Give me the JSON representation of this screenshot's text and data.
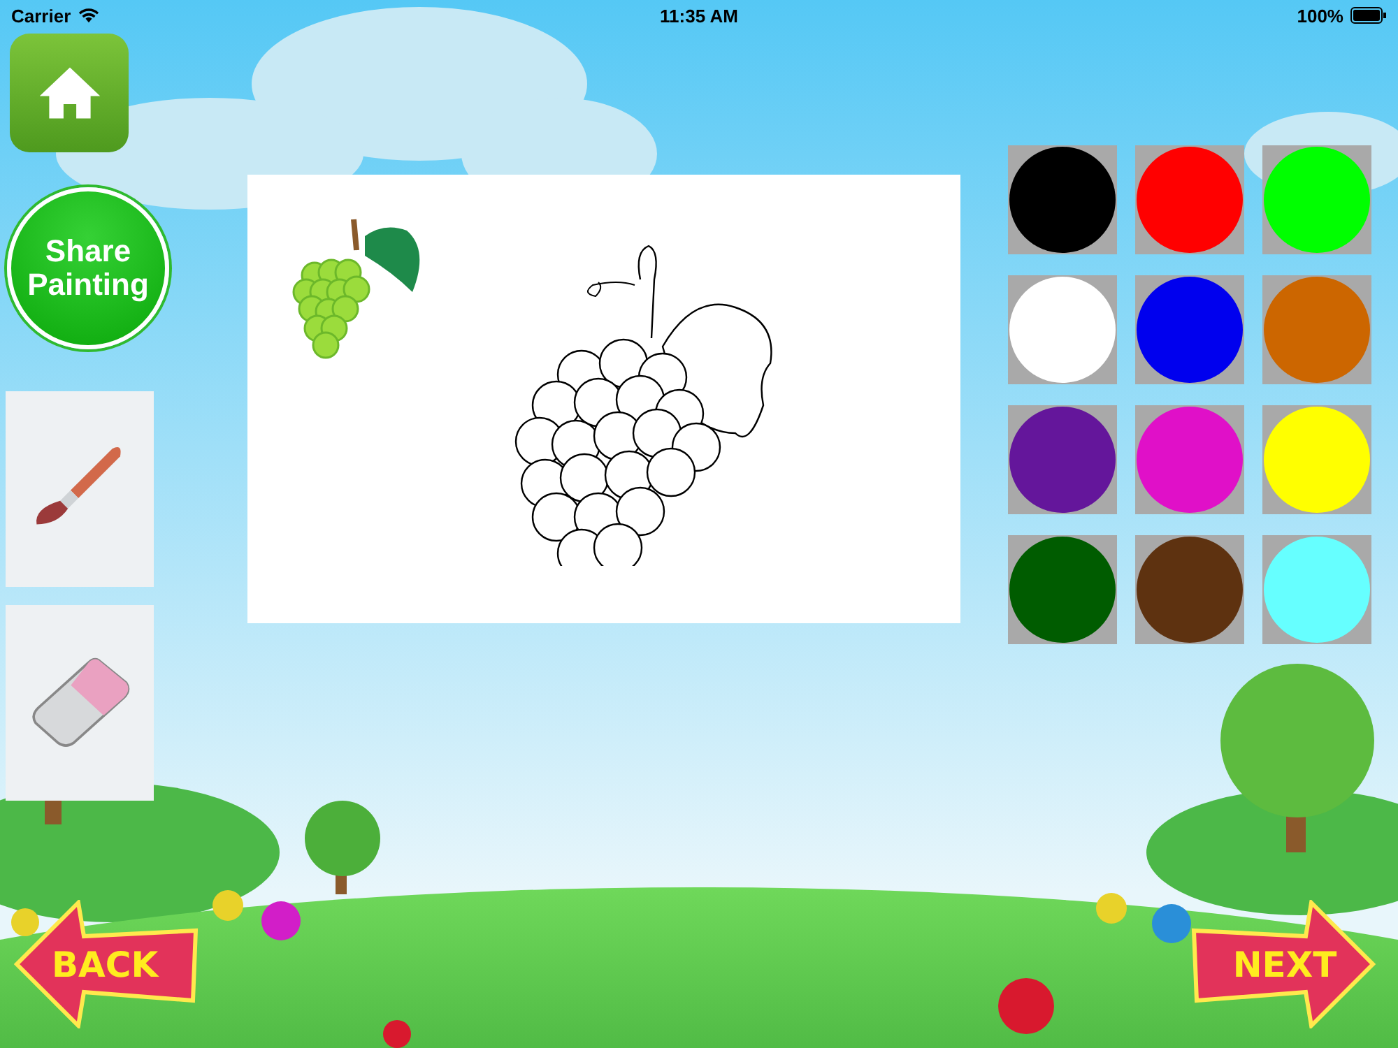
{
  "status_bar": {
    "carrier": "Carrier",
    "time": "11:35 AM",
    "battery": "100%"
  },
  "share_button": {
    "label": "Share Painting"
  },
  "tools": [
    {
      "kind": "brush"
    },
    {
      "kind": "eraser"
    }
  ],
  "palette": [
    {
      "color": "#000000"
    },
    {
      "color": "#ff0000"
    },
    {
      "color": "#00ff00"
    },
    {
      "color": "#ffffff"
    },
    {
      "color": "#0000ee"
    },
    {
      "color": "#cc6600"
    },
    {
      "color": "#64169b"
    },
    {
      "color": "#e010c8"
    },
    {
      "color": "#ffff00"
    },
    {
      "color": "#005c00"
    },
    {
      "color": "#5e3210"
    },
    {
      "color": "#66ffff"
    }
  ],
  "navigation": {
    "back": "BACK",
    "next": "NEXT"
  }
}
